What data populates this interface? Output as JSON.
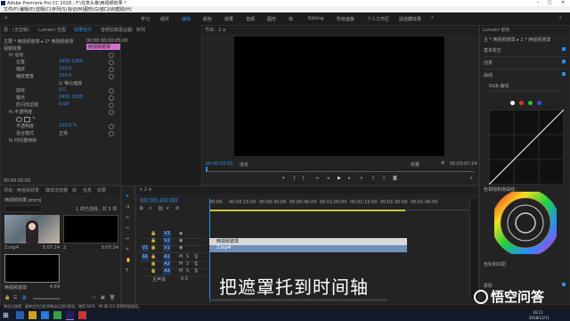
{
  "window": {
    "title": "Adobe Premiere Pro CC 2018 - F:\\任意头像\\两视频效果 *",
    "menu": [
      "文件(F)",
      "编辑(E)",
      "剪辑(C)",
      "序列(S)",
      "标记(M)",
      "图形(G)",
      "窗口(W)",
      "帮助(H)"
    ]
  },
  "workspaces": [
    "学习",
    "组件",
    "编辑",
    "颜色",
    "效果",
    "音频",
    "图形",
    "库",
    "Editing",
    "所有面板",
    "个人工作区",
    "捉迷藏效果"
  ],
  "workspace_active": 2,
  "effect_controls": {
    "tabs": [
      "源：(无剪辑)",
      "Lumetri 范围",
      "效果控件",
      "音频剪辑混合器：序列"
    ],
    "clip_path": "主要 * 两视频遮罩 ▸ 2* 两视频遮罩",
    "time_left": "00:00",
    "time_right": "00:00:05:00",
    "section_video": "视频效果",
    "clip_bar_label": "两视频遮罩",
    "rows": [
      {
        "label": "fx 运动",
        "value": ""
      },
      {
        "label": "位置",
        "value": "2450   1360"
      },
      {
        "label": "缩放",
        "value": "100.0"
      },
      {
        "label": "缩放宽度",
        "value": "100.0"
      },
      {
        "label": "",
        "value": "☑ 等比缩放"
      },
      {
        "label": "旋转",
        "value": "0.0"
      },
      {
        "label": "锚点",
        "value": "2450   1360"
      },
      {
        "label": "防闪烁滤镜",
        "value": "0.00"
      },
      {
        "label": "fx 不透明度",
        "value": ""
      },
      {
        "label": "",
        "value": ""
      },
      {
        "label": "不透明度",
        "value": "100.0 %"
      },
      {
        "label": "混合模式",
        "value": "正常"
      },
      {
        "label": "fx 时间重映射",
        "value": ""
      }
    ],
    "timecode": "00:00:00:00"
  },
  "program_monitor": {
    "tab": "节目：2 ≡",
    "timecode_left": "00:00:00:00",
    "fit": "适合",
    "quality": "完整",
    "timecode_right": "00:03:07:24"
  },
  "lumetri": {
    "tab": "Lumetri 颜色",
    "clip_path": "主 * 两视频遮罩  ▸  2 * 两视频遮罩",
    "checks": [
      {
        "label": "基本校正"
      },
      {
        "label": "创意"
      },
      {
        "label": "曲线"
      }
    ],
    "hue_label": "RGB 曲线",
    "hue_sub": "色相饱和度曲线",
    "color_wheels": "色轮和匹配",
    "wheel_dots_colors": [
      "#ffffff",
      "#e03030",
      "#30c030",
      "#3050e0"
    ],
    "vignette": "晕影"
  },
  "project": {
    "tabs": [
      "项目：两视频效果",
      "媒体浏览器",
      "库",
      "信息",
      "效果"
    ],
    "project_name": "两视频效果.prproj",
    "count": "1 项已选择，共 3 项",
    "items": [
      {
        "name": "2.mp4",
        "duration": "5:07:24"
      },
      {
        "name": "2",
        "duration": "5:07:24"
      },
      {
        "name": "两视频遮罩",
        "duration": "4:59"
      }
    ]
  },
  "timeline": {
    "tab": "× 2 ≡",
    "timecode": "00:00:00:00",
    "ruler_labels": [
      "00:00",
      "00:00:15:00",
      "00:00:30:00",
      "00:00:45:00",
      "00:01:00:00",
      "00:01:15:00",
      "00:01:30:00",
      "00:01:45:00"
    ],
    "tracks": [
      {
        "name": "V3"
      },
      {
        "name": "V2"
      },
      {
        "name": "V1"
      },
      {
        "name": "A1"
      },
      {
        "name": "A2"
      },
      {
        "name": "A3"
      }
    ],
    "master": "主声道",
    "master_value": "0.0",
    "clip_v2": "两视频遮罩",
    "clip_v1": "2.mp4",
    "caption": "把遮罩托到时间轴"
  },
  "status": {
    "text": "单击以选择，或单击空白处并拖动以进行框选。使用 Shift、Alt 和 Ctrl 获得其他选项。",
    "time": "16:11",
    "date": "2018/12/11"
  },
  "watermark": {
    "text": "悟空问答"
  }
}
